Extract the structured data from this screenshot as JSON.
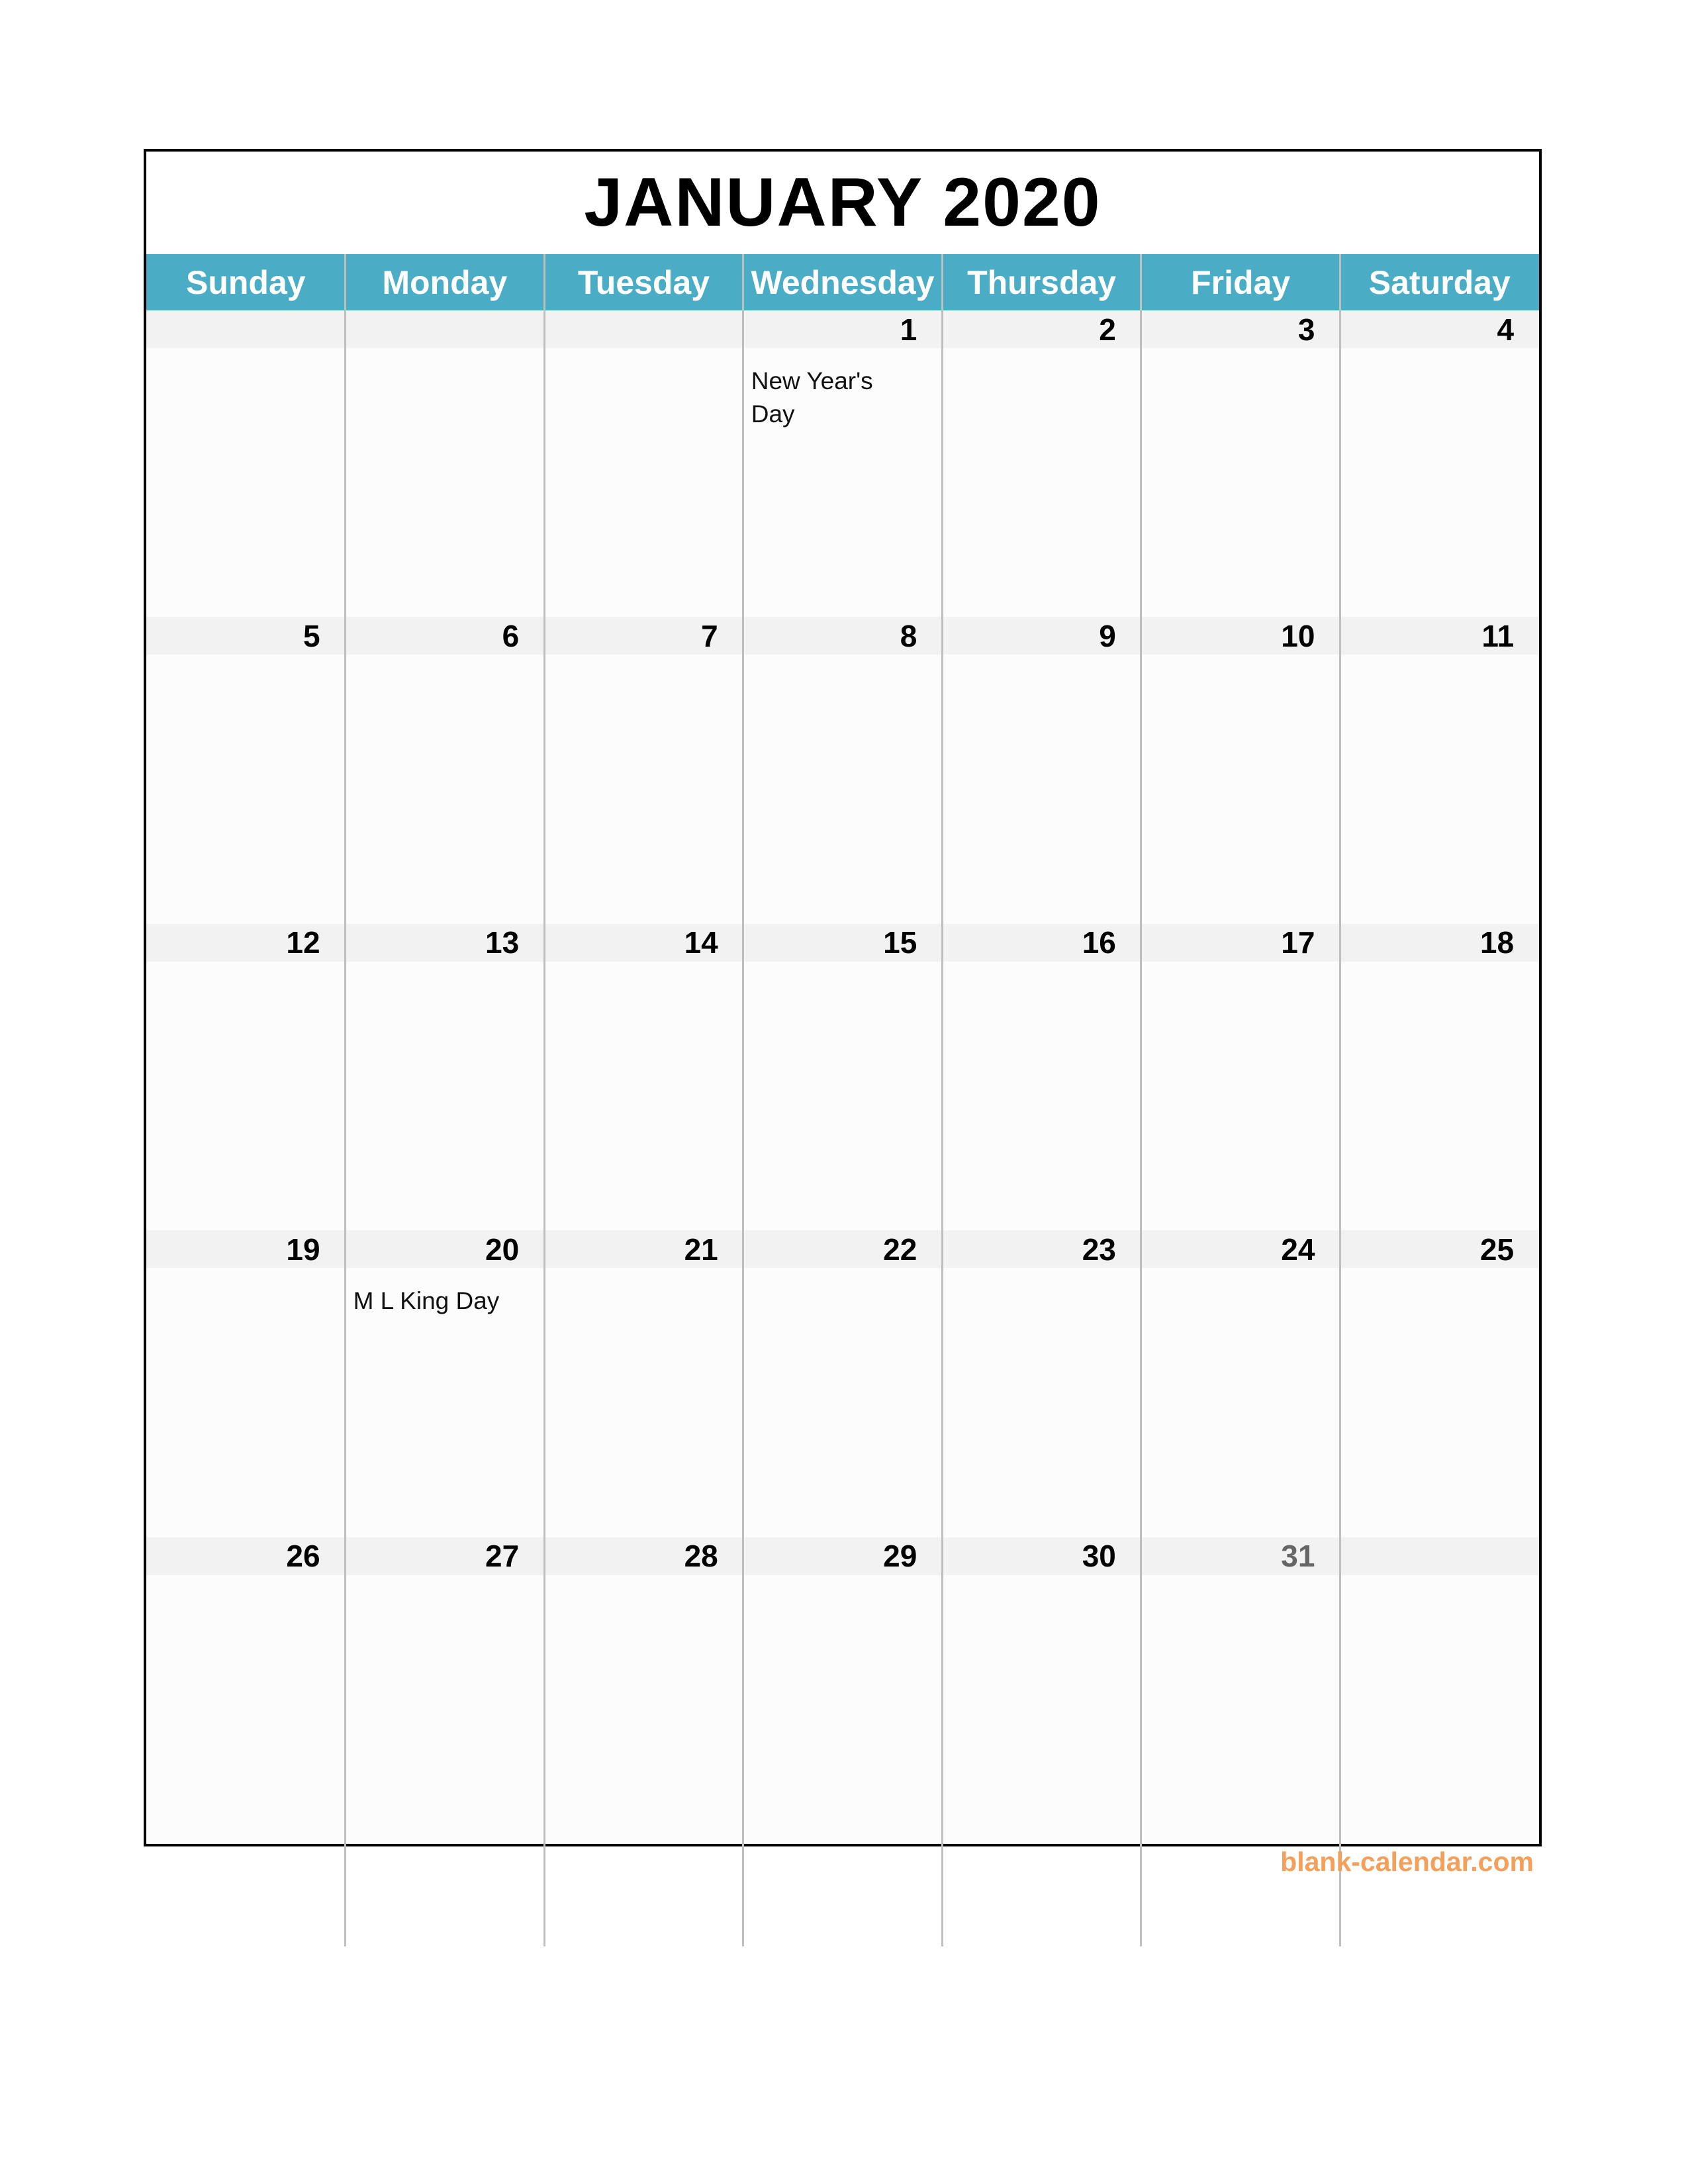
{
  "calendar": {
    "title": "JANUARY 2020",
    "days_of_week": [
      "Sunday",
      "Monday",
      "Tuesday",
      "Wednesday",
      "Thursday",
      "Friday",
      "Saturday"
    ],
    "weeks": [
      [
        {
          "date": ""
        },
        {
          "date": ""
        },
        {
          "date": ""
        },
        {
          "date": "1",
          "event": "New Year's Day"
        },
        {
          "date": "2"
        },
        {
          "date": "3"
        },
        {
          "date": "4"
        }
      ],
      [
        {
          "date": "5"
        },
        {
          "date": "6"
        },
        {
          "date": "7"
        },
        {
          "date": "8"
        },
        {
          "date": "9"
        },
        {
          "date": "10"
        },
        {
          "date": "11"
        }
      ],
      [
        {
          "date": "12"
        },
        {
          "date": "13"
        },
        {
          "date": "14"
        },
        {
          "date": "15"
        },
        {
          "date": "16"
        },
        {
          "date": "17"
        },
        {
          "date": "18"
        }
      ],
      [
        {
          "date": "19"
        },
        {
          "date": "20",
          "event": "M L King Day"
        },
        {
          "date": "21"
        },
        {
          "date": "22"
        },
        {
          "date": "23"
        },
        {
          "date": "24"
        },
        {
          "date": "25"
        }
      ],
      [
        {
          "date": "26"
        },
        {
          "date": "27"
        },
        {
          "date": "28"
        },
        {
          "date": "29"
        },
        {
          "date": "30"
        },
        {
          "date": "31",
          "dim": true
        },
        {
          "date": ""
        }
      ]
    ]
  },
  "colors": {
    "header_bg": "#4BACC6",
    "date_strip_bg": "#F2F2F2",
    "cell_bg": "#FCFCFC",
    "watermark": "#F4A05A",
    "dim_date": "#666666"
  },
  "footer": {
    "watermark": "blank-calendar.com"
  }
}
